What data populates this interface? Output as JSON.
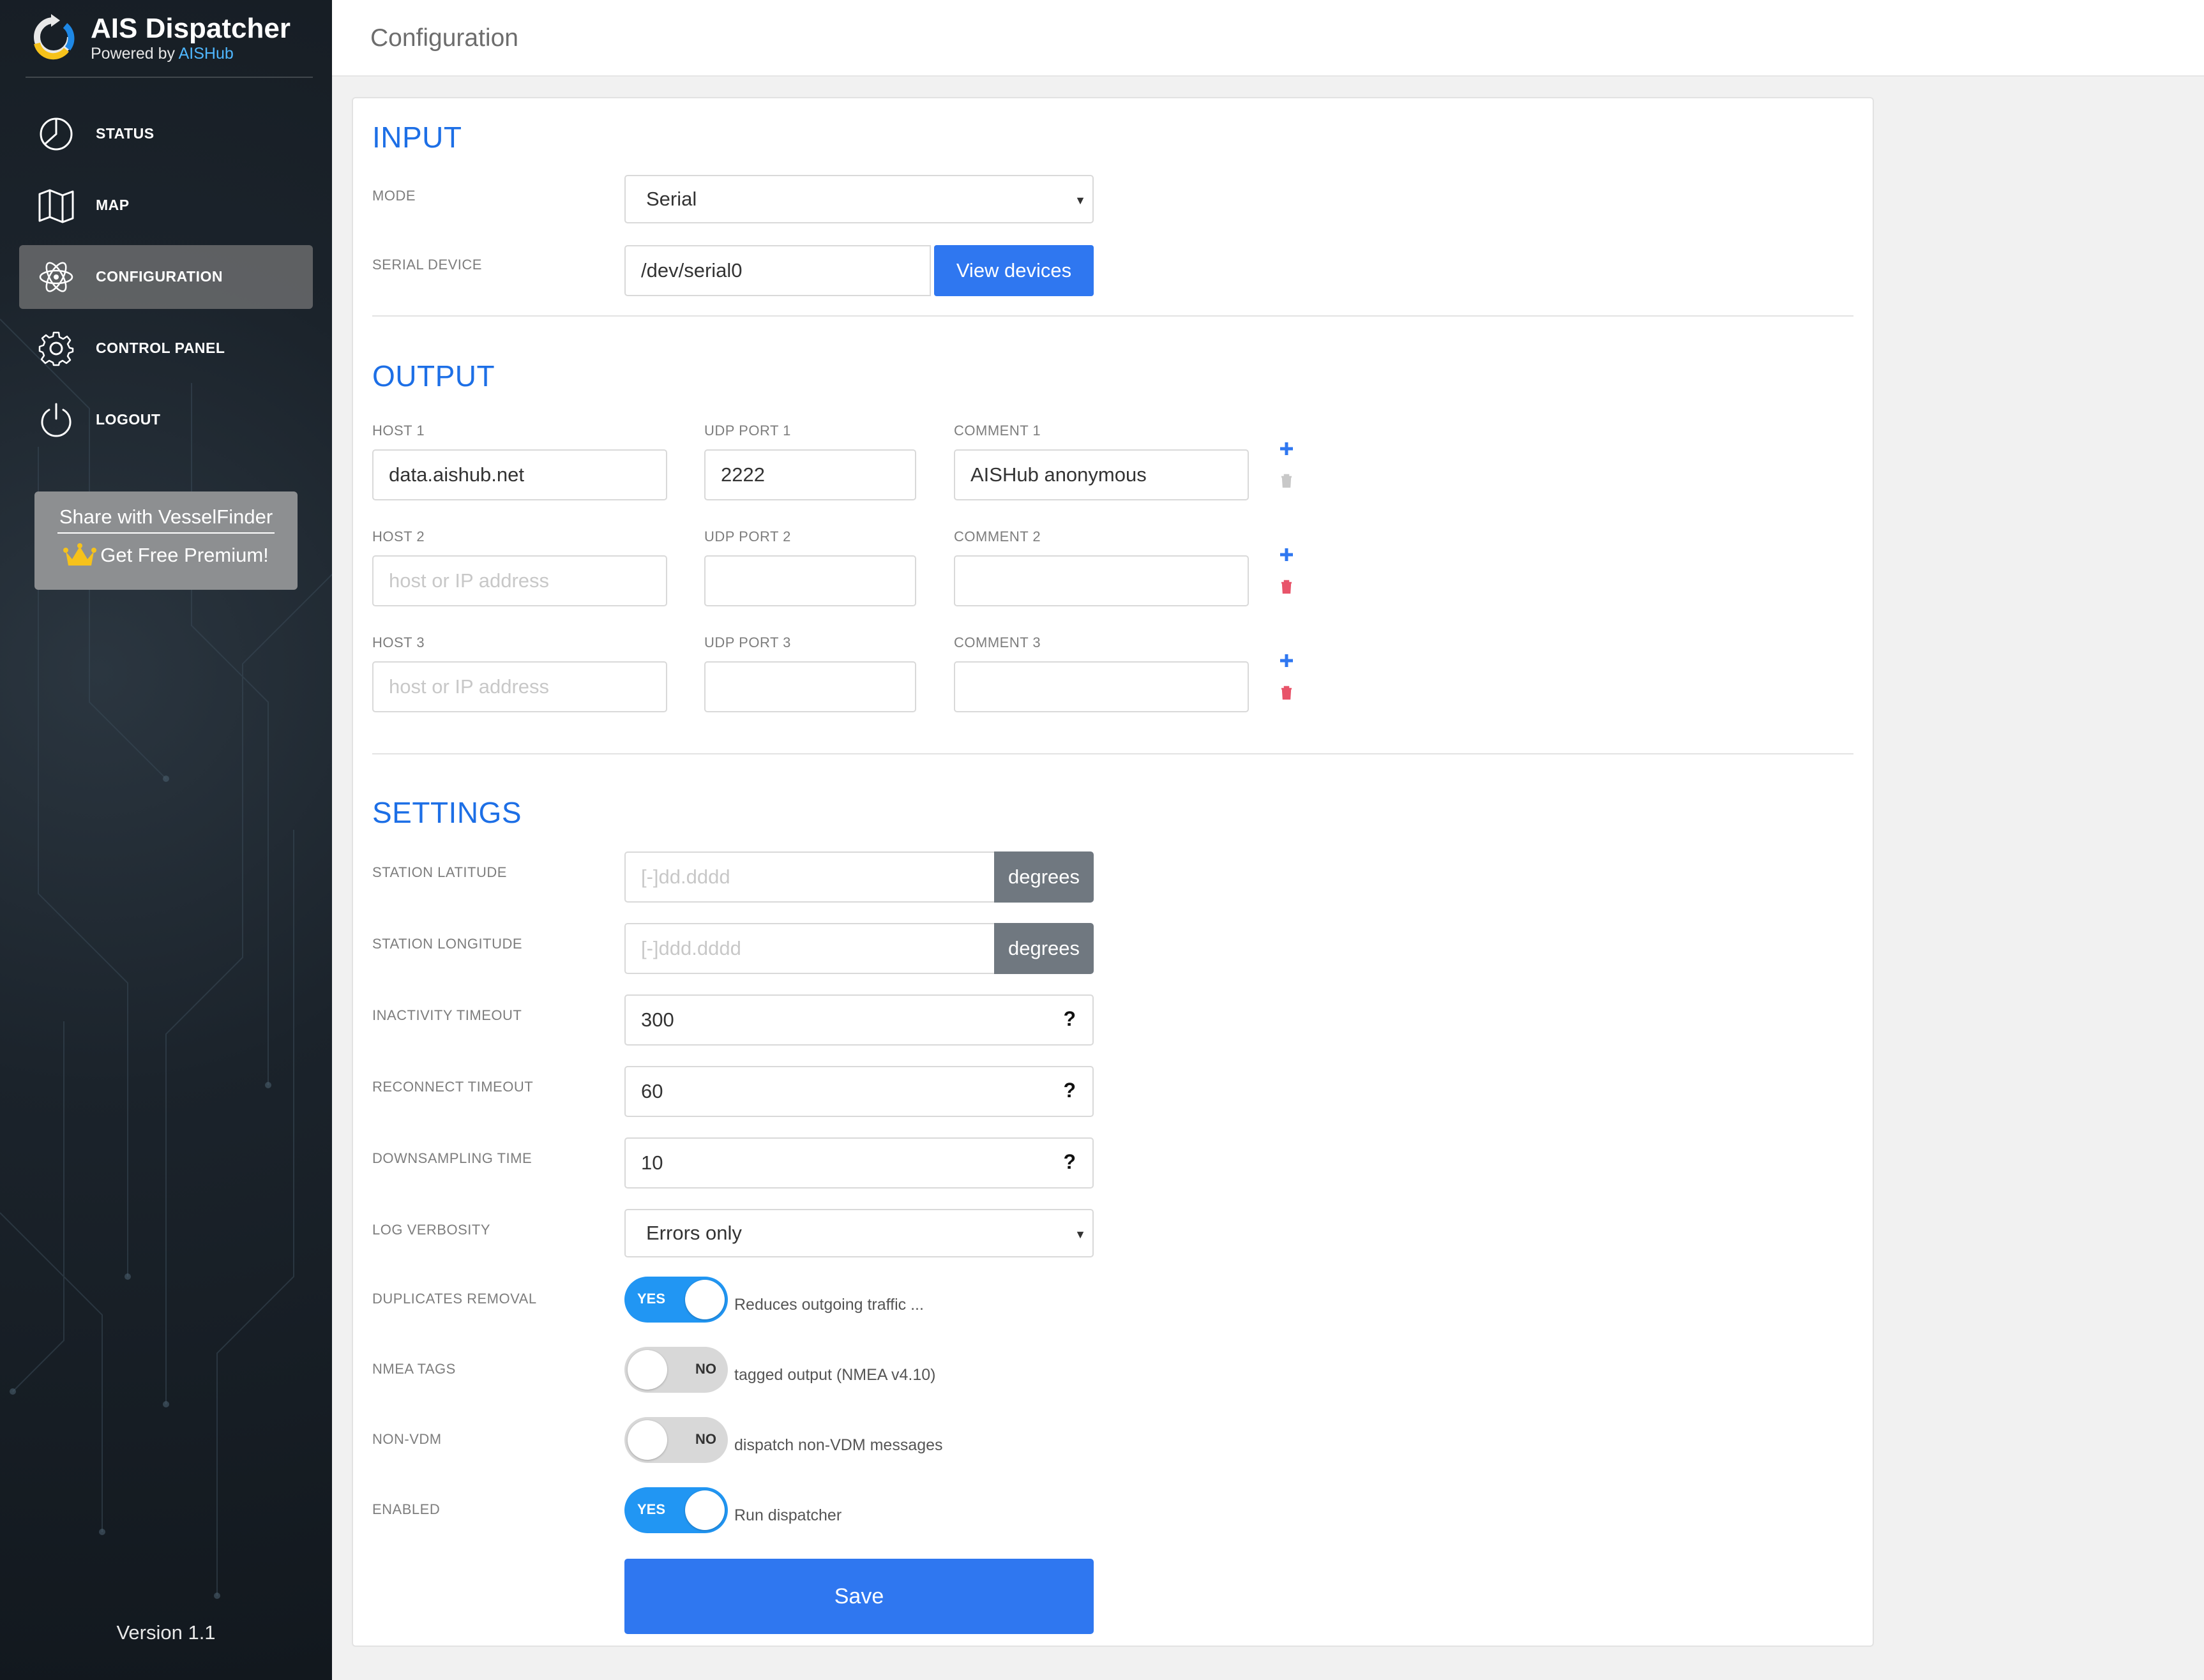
{
  "app": {
    "title": "AIS Dispatcher",
    "powered_by": "Powered by",
    "powered_brand": "AISHub",
    "version": "Version 1.1"
  },
  "nav": [
    {
      "label": "STATUS",
      "icon": "pie-chart-icon"
    },
    {
      "label": "MAP",
      "icon": "map-icon"
    },
    {
      "label": "CONFIGURATION",
      "icon": "atom-icon",
      "active": true
    },
    {
      "label": "CONTROL PANEL",
      "icon": "gear-icon"
    },
    {
      "label": "LOGOUT",
      "icon": "power-icon"
    }
  ],
  "share": {
    "line1": "Share with VesselFinder",
    "line2": "Get Free Premium!"
  },
  "page": {
    "title": "Configuration"
  },
  "input": {
    "title": "INPUT",
    "mode_label": "MODE",
    "mode_value": "Serial",
    "serial_label": "SERIAL DEVICE",
    "serial_value": "/dev/serial0",
    "view_devices": "View devices"
  },
  "output": {
    "title": "OUTPUT",
    "rows": [
      {
        "host_label": "HOST 1",
        "host_value": "data.aishub.net",
        "port_label": "UDP PORT 1",
        "port_value": "2222",
        "comment_label": "COMMENT 1",
        "comment_value": "AISHub anonymous"
      },
      {
        "host_label": "HOST 2",
        "host_value": "",
        "port_label": "UDP PORT 2",
        "port_value": "",
        "comment_label": "COMMENT 2",
        "comment_value": ""
      },
      {
        "host_label": "HOST 3",
        "host_value": "",
        "port_label": "UDP PORT 3",
        "port_value": "",
        "comment_label": "COMMENT 3",
        "comment_value": ""
      }
    ],
    "host_placeholder": "host or IP address"
  },
  "settings": {
    "title": "SETTINGS",
    "lat_label": "STATION LATITUDE",
    "lat_placeholder": "[-]dd.dddd",
    "lon_label": "STATION LONGITUDE",
    "lon_placeholder": "[-]ddd.dddd",
    "degrees": "degrees",
    "inactivity_label": "INACTIVITY TIMEOUT",
    "inactivity_value": "300",
    "reconnect_label": "RECONNECT TIMEOUT",
    "reconnect_value": "60",
    "downsampling_label": "DOWNSAMPLING TIME",
    "downsampling_value": "10",
    "help_glyph": "?",
    "log_label": "LOG VERBOSITY",
    "log_value": "Errors only",
    "dup_label": "DUPLICATES REMOVAL",
    "dup_state": "YES",
    "dup_desc": "Reduces outgoing traffic ...",
    "nmea_label": "NMEA TAGS",
    "nmea_state": "NO",
    "nmea_desc": "tagged output (NMEA v4.10)",
    "nonvdm_label": "NON-VDM",
    "nonvdm_state": "NO",
    "nonvdm_desc": "dispatch non-VDM messages",
    "enabled_label": "ENABLED",
    "enabled_state": "YES",
    "enabled_desc": "Run dispatcher"
  },
  "save_label": "Save",
  "colors": {
    "accent": "#2f77f0",
    "section_title": "#1d6fe6",
    "toggle_on": "#2196f3",
    "delete_red": "#e8546a",
    "sidebar_bg": "#1b232b"
  }
}
